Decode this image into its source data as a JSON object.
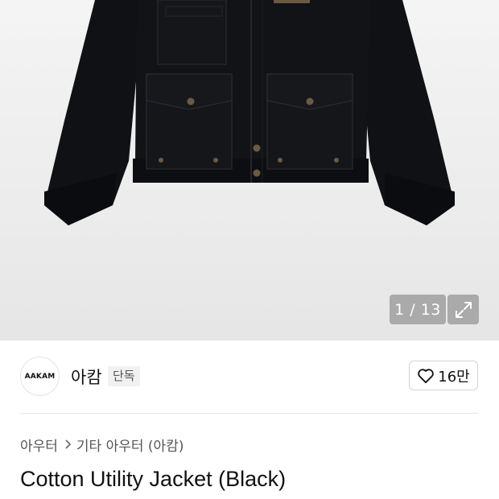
{
  "gallery": {
    "counter": "1 / 13",
    "expand_icon": "expand-icon",
    "image": "black cotton utility jacket"
  },
  "brand": {
    "logo_text": "AAKAM",
    "name": "아캄",
    "badge": "단독"
  },
  "likes": {
    "icon": "heart-outline-icon",
    "count": "16만"
  },
  "breadcrumb": {
    "level1": "아우터",
    "separator_icon": "chevron-right-icon",
    "level2": "기타 아우터 (아캄)"
  },
  "product": {
    "title": "Cotton Utility Jacket (Black)"
  }
}
